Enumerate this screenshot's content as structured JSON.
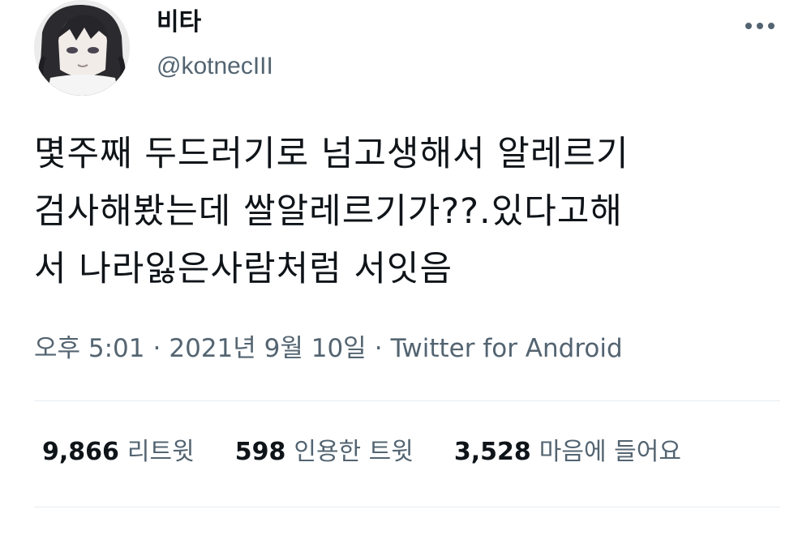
{
  "user": {
    "display_name": "비타",
    "handle": "@kotnecIII",
    "avatar_icon": "anime-avatar"
  },
  "more_icon": "more-horizontal-icon",
  "tweet": {
    "lines": [
      "몇주째 두드러기로 넘고생해서 알레르기",
      "검사해봤는데 쌀알레르기가??.있다고해",
      "서 나라잃은사람처럼 서잇음"
    ]
  },
  "meta": {
    "time": "오후 5:01",
    "separator": "·",
    "date": "2021년 9월 10일",
    "source": "Twitter for Android"
  },
  "stats": {
    "retweets": {
      "count": "9,866",
      "label": "리트윗"
    },
    "quotes": {
      "count": "598",
      "label": "인용한 트윗"
    },
    "likes": {
      "count": "3,528",
      "label": "마음에 들어요"
    }
  },
  "colors": {
    "primary_text": "#0f1419",
    "secondary_text": "#536471",
    "divider": "#e6ecf0"
  }
}
